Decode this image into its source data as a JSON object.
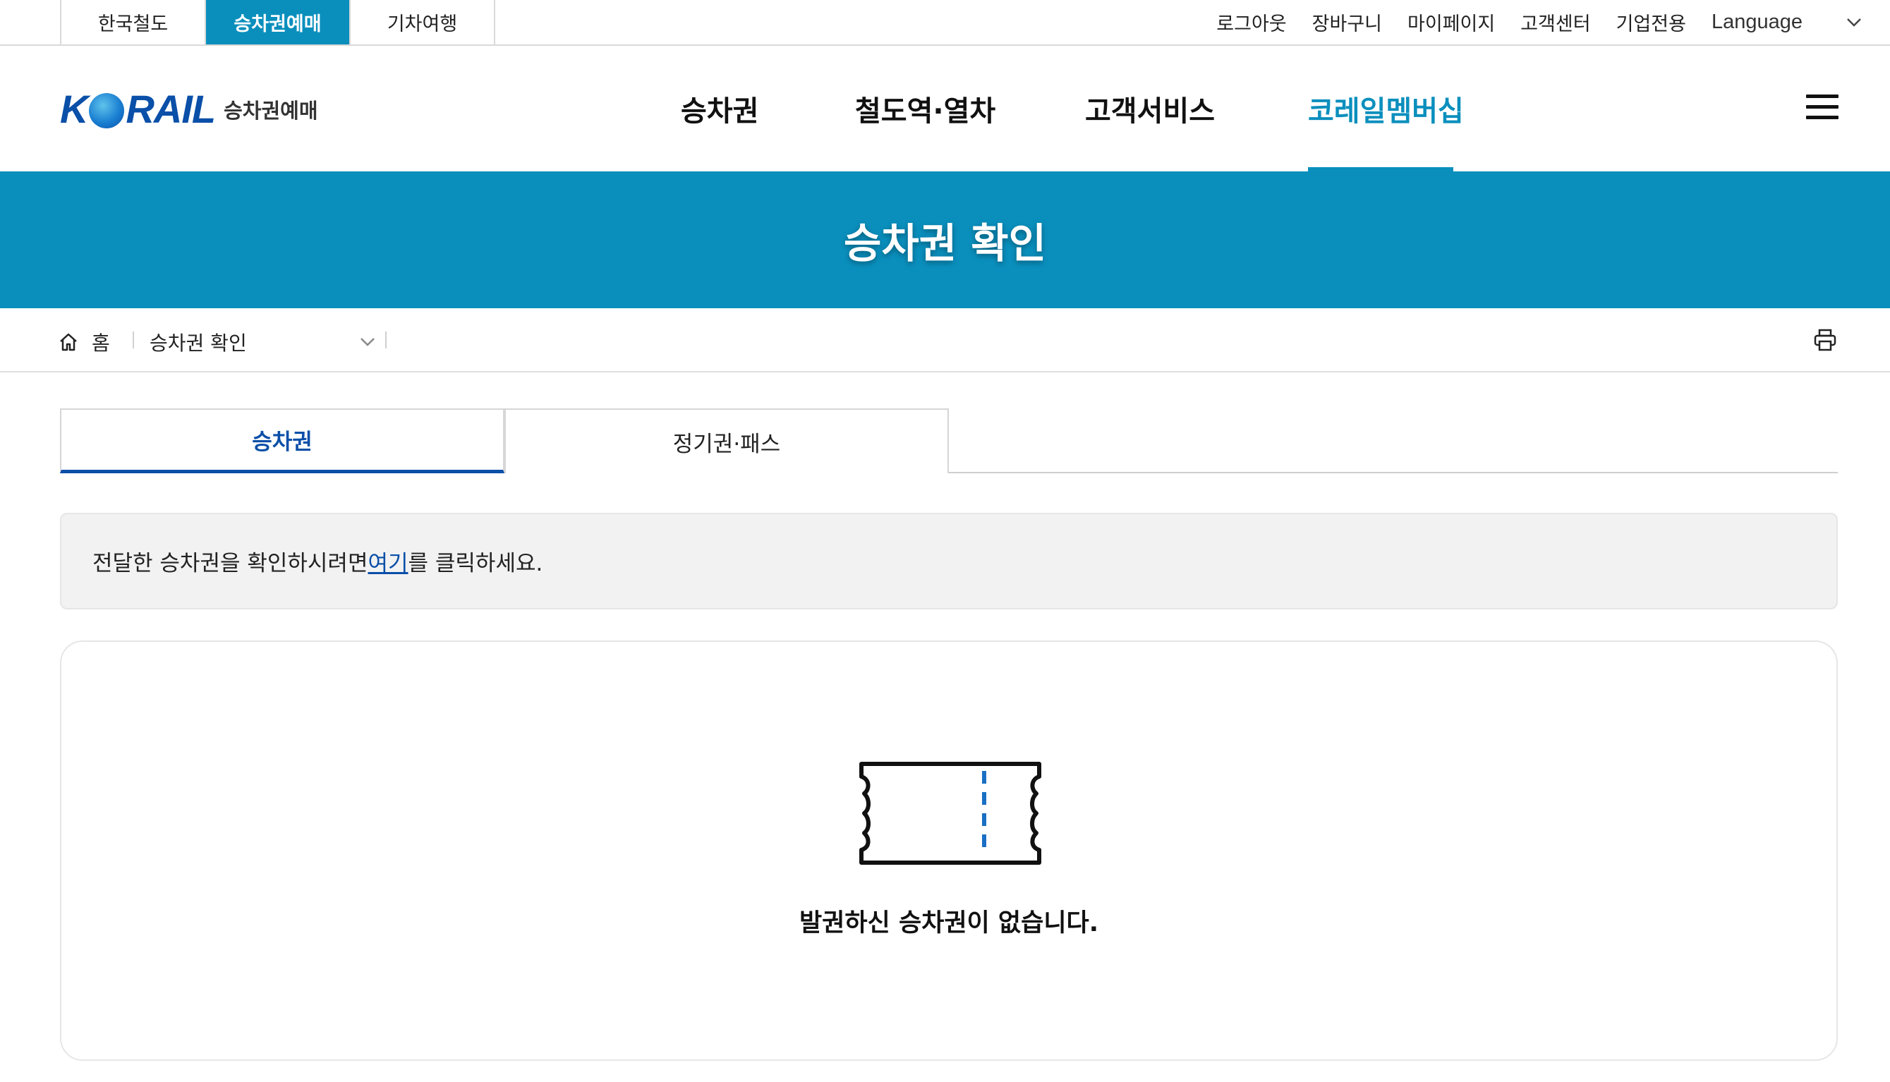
{
  "utility": {
    "site_tabs": [
      {
        "label": "한국철도"
      },
      {
        "label": "승차권예매"
      },
      {
        "label": "기차여행"
      }
    ],
    "links": [
      {
        "label": "로그아웃"
      },
      {
        "label": "장바구니"
      },
      {
        "label": "마이페이지"
      },
      {
        "label": "고객센터"
      },
      {
        "label": "기업전용"
      }
    ],
    "language": "Language"
  },
  "header": {
    "logo_text_1": "K",
    "logo_text_2": "RAIL",
    "logo_sub": "승차권예매",
    "nav": [
      {
        "label": "승차권"
      },
      {
        "label": "철도역·열차"
      },
      {
        "label": "고객서비스"
      },
      {
        "label": "코레일멤버십"
      }
    ],
    "active_nav": "코레일멤버십"
  },
  "banner": {
    "title": "승차권 확인"
  },
  "breadcrumb": {
    "home": "홈",
    "current": "승차권 확인"
  },
  "tabs": [
    {
      "label": "승차권"
    },
    {
      "label": "정기권·패스"
    }
  ],
  "info": {
    "before": "전달한 승차권을 확인하시려면 ",
    "link": "여기",
    "after": "를 클릭하세요."
  },
  "empty": {
    "message": "발권하신 승차권이 없습니다."
  },
  "colors": {
    "brand_blue": "#0a8fbd",
    "dark_blue": "#0a4fa8",
    "ticket_dash": "#1a6fc4"
  }
}
